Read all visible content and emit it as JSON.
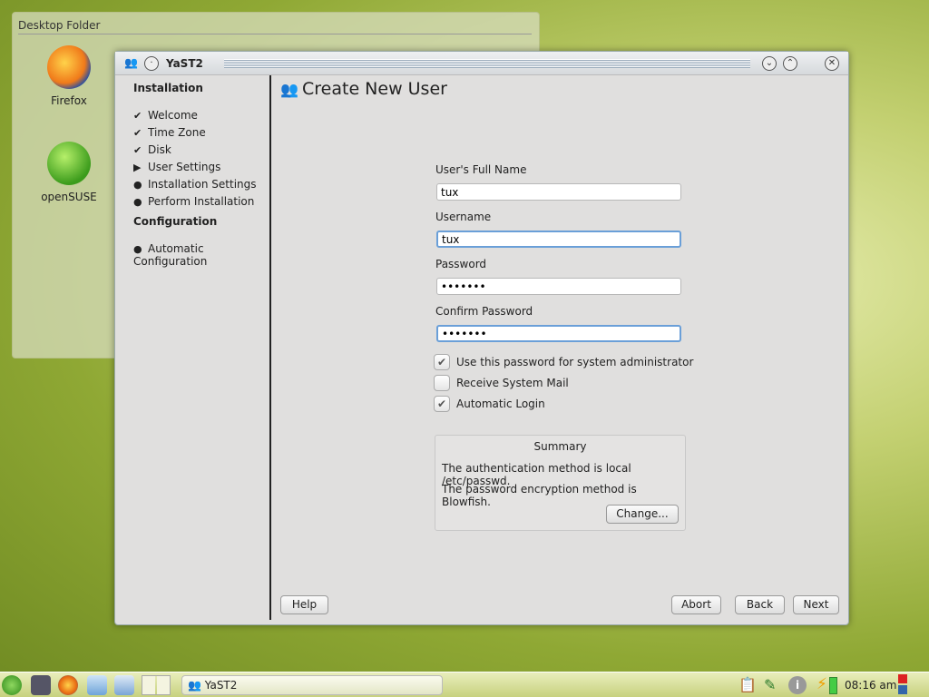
{
  "desktop": {
    "folder_title": "Desktop Folder",
    "icons": [
      {
        "label": "Firefox"
      },
      {
        "label": "openSUSE"
      }
    ]
  },
  "window": {
    "title": "YaST2",
    "minimize": "⌄",
    "maximize": "⌃",
    "close": "✕"
  },
  "sidebar": {
    "sections": [
      {
        "title": "Installation",
        "items": [
          {
            "label": "Welcome",
            "state": "done",
            "mark": "✔"
          },
          {
            "label": "Time Zone",
            "state": "done",
            "mark": "✔"
          },
          {
            "label": "Disk",
            "state": "done",
            "mark": "✔"
          },
          {
            "label": "User Settings",
            "state": "current",
            "mark": "▶"
          },
          {
            "label": "Installation Settings",
            "state": "pending",
            "mark": "●"
          },
          {
            "label": "Perform Installation",
            "state": "pending",
            "mark": "●"
          }
        ]
      },
      {
        "title": "Configuration",
        "items": [
          {
            "label": "Automatic Configuration",
            "state": "pending",
            "mark": "●"
          }
        ]
      }
    ]
  },
  "main": {
    "title": "Create New User",
    "fields": [
      {
        "label": "User's Full Name",
        "value": "tux"
      },
      {
        "label": "Username",
        "value": "tux"
      },
      {
        "label": "Password",
        "value": "•••••••"
      },
      {
        "label": "Confirm Password",
        "value": "•••••••"
      }
    ],
    "checkboxes": [
      {
        "label": "Use this password for system administrator",
        "checked": true
      },
      {
        "label": "Receive System Mail",
        "checked": false
      },
      {
        "label": "Automatic Login",
        "checked": true
      }
    ],
    "summary": {
      "title": "Summary",
      "lines": [
        "The authentication method is local /etc/passwd.",
        "The password encryption method is Blowfish."
      ],
      "change": "Change..."
    },
    "buttons": {
      "help": "Help",
      "abort": "Abort",
      "back": "Back",
      "next": "Next"
    }
  },
  "taskbar": {
    "task": "YaST2",
    "clock": "08:16 am"
  }
}
